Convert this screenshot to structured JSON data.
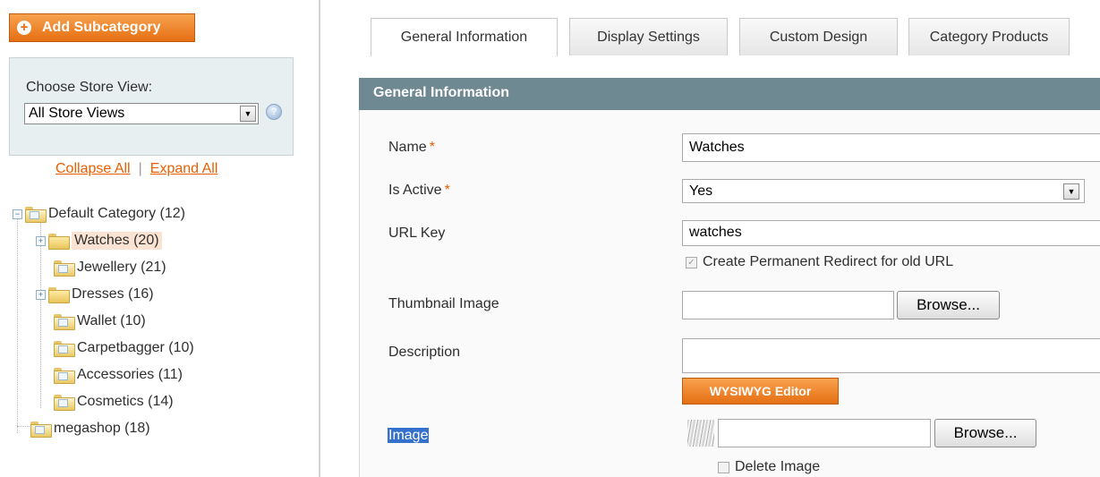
{
  "sidebar": {
    "add_subcategory_label": "Add Subcategory",
    "store_view_label": "Choose Store View:",
    "store_view_value": "All Store Views",
    "collapse_all": "Collapse All",
    "separator": "|",
    "expand_all": "Expand All",
    "tree": [
      {
        "label": "Default Category (12)",
        "icon": "folder-open-icon"
      },
      {
        "label": "Watches (20)",
        "icon": "folder-icon",
        "selected": true
      },
      {
        "label": "Jewellery (21)",
        "icon": "folder-doc-icon"
      },
      {
        "label": "Dresses (16)",
        "icon": "folder-icon"
      },
      {
        "label": "Wallet (10)",
        "icon": "folder-doc-icon"
      },
      {
        "label": "Carpetbagger (10)",
        "icon": "folder-doc-icon"
      },
      {
        "label": "Accessories (11)",
        "icon": "folder-doc-icon"
      },
      {
        "label": "Cosmetics (14)",
        "icon": "folder-doc-icon"
      },
      {
        "label": "megashop (18)",
        "icon": "folder-doc-icon"
      }
    ]
  },
  "tabs": [
    {
      "label": "General Information",
      "active": true
    },
    {
      "label": "Display Settings"
    },
    {
      "label": "Custom Design"
    },
    {
      "label": "Category Products"
    }
  ],
  "section": {
    "title": "General Information"
  },
  "form": {
    "name_label": "Name",
    "name_value": "Watches",
    "is_active_label": "Is Active",
    "is_active_value": "Yes",
    "url_key_label": "URL Key",
    "url_key_value": "watches",
    "redirect_label": "Create Permanent Redirect for old URL",
    "thumbnail_label": "Thumbnail Image",
    "thumbnail_value": "",
    "browse_label": "Browse...",
    "description_label": "Description",
    "description_value": "",
    "wysiwyg_label": "WYSIWYG Editor",
    "image_label": "Image",
    "image_value": "",
    "delete_image_label": "Delete Image",
    "required_mark": "*"
  },
  "colors": {
    "accent_orange": "#e66f13",
    "section_header": "#6f8992",
    "selection_highlight": "#3470cc",
    "link_orange": "#eb5e00"
  }
}
